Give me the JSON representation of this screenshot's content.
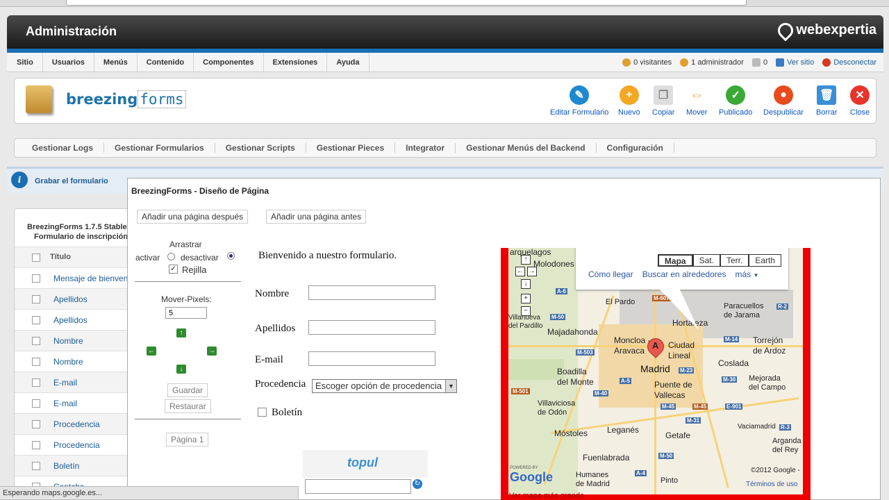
{
  "header": {
    "title": "Administración",
    "brand": "webexpertia"
  },
  "menu": {
    "items": [
      "Sitio",
      "Usuarios",
      "Menús",
      "Contenido",
      "Componentes",
      "Extensiones",
      "Ayuda"
    ]
  },
  "status": {
    "visitors": "0 visitantes",
    "admins": "1 administrador",
    "messages": "0",
    "view_site": "Ver sitio",
    "logout": "Desconectar"
  },
  "logo": {
    "text_bold": "breezing",
    "text_mono": "forms"
  },
  "toolbar": {
    "buttons": [
      {
        "label": "Editar Formulario",
        "icon": "pencil-icon",
        "color": "#1e88d0"
      },
      {
        "label": "Nuevo",
        "icon": "plus-icon",
        "color": "#f5a623"
      },
      {
        "label": "Copiar",
        "icon": "copy-icon",
        "color": "#cfcfcf"
      },
      {
        "label": "Mover",
        "icon": "move-icon",
        "color": "#f5a623"
      },
      {
        "label": "Publicado",
        "icon": "check-icon",
        "color": "#3aa935"
      },
      {
        "label": "Despublicar",
        "icon": "stop-icon",
        "color": "#e84c1c"
      },
      {
        "label": "Borrar",
        "icon": "trash-icon",
        "color": "#3a8fd6"
      },
      {
        "label": "Close",
        "icon": "close-icon",
        "color": "#e8342a"
      }
    ]
  },
  "submenu": {
    "items": [
      "Gestionar Logs",
      "Gestionar Formularios",
      "Gestionar Scripts",
      "Gestionar Pieces",
      "Integrator",
      "Gestionar Menús del Backend",
      "Configuración"
    ]
  },
  "info": {
    "text": "Grabar el formulario"
  },
  "left_panel": {
    "title_line1": "BreezingForms 1.7.5 Stable",
    "title_line2": "Formulario de inscripción",
    "column_title": "Título",
    "rows": [
      "Mensaje de bienvenida",
      "Apellidos",
      "Apellidos",
      "Nombre",
      "Nombre",
      "E-mail",
      "E-mail",
      "Procedencia",
      "Procedencia",
      "Boletín",
      "Captcha"
    ]
  },
  "designer": {
    "title": "BreezingForms - Diseño de Página",
    "add_after": "Añadir una página después",
    "add_before": "Añadir una página antes",
    "drag_label": "Arrastrar",
    "activate": "activar",
    "deactivate": "desactivar",
    "grid": "Rejilla",
    "move_pixels_label": "Mover-Pixels:",
    "move_pixels_value": "5",
    "save": "Guardar",
    "restore": "Restaurar",
    "page": "Página 1"
  },
  "form": {
    "welcome": "Bienvenido a nuestro formulario.",
    "name_label": "Nombre",
    "surname_label": "Apellidos",
    "email_label": "E-mail",
    "origin_label": "Procedencia",
    "origin_selected": "Escoger opción de procedencia",
    "newsletter_label": "Boletín",
    "captcha_text": "topul"
  },
  "map": {
    "types": [
      "Mapa",
      "Sat.",
      "Terr.",
      "Earth"
    ],
    "selected_type": "Mapa",
    "links": [
      "Cómo llegar",
      "Buscar en alrededores",
      "más"
    ],
    "places": {
      "madrid": "Madrid",
      "moncloa": "Moncloa -\nAravaca",
      "ciudad_lineal": "Ciudad\nLineal",
      "hortaleza": "Hortaleza",
      "majadahonda": "Majadahonda",
      "el_pardo": "El Pardo",
      "paracuellos": "Paracuellos\nde Jarama",
      "torrejon": "Torrejón\nde Ardoz",
      "coslada": "Coslada",
      "boadilla": "Boadilla\ndel Monte",
      "puente_vallecas": "Puente de\nVallecas",
      "mejorada": "Mejorada\ndel Campo",
      "villaviciosa": "Villaviciosa\nde Odón",
      "mostoles": "Móstoles",
      "leganes": "Leganés",
      "getafe": "Getafe",
      "vaciamadrid": "Vaciamadrid",
      "arganda": "Arganda\ndel Rey",
      "fuenlabrada": "Fuenlabrada",
      "humanes": "Humanes\nde Madrid",
      "pinto": "Pinto",
      "villanueva": "Villanueva\ndel Pardillo",
      "quejigo": "arquelagos",
      "rozas": "Molodones"
    },
    "copyright": "©2012 Google -",
    "terms": "Términos de uso",
    "powered": "POWERED BY",
    "google": "Google",
    "bottom_link": "Ver mapa más grande"
  },
  "statusbar": {
    "text": "Esperando maps.google.es..."
  }
}
